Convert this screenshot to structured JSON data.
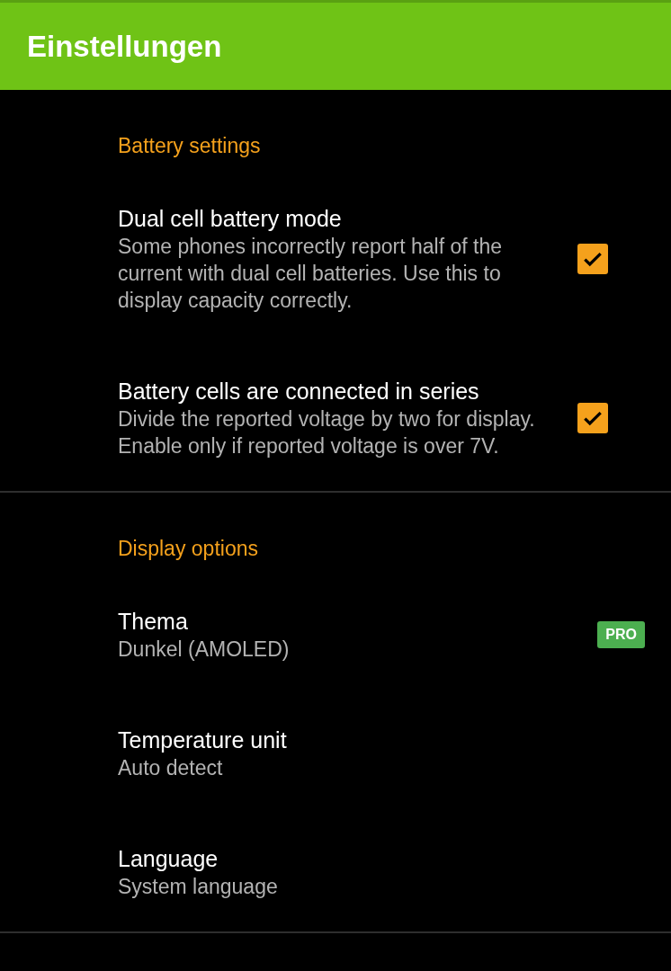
{
  "app_bar": {
    "title": "Einstellungen"
  },
  "sections": [
    {
      "title": "Battery settings",
      "items": [
        {
          "kind": "checkbox",
          "title": "Dual cell battery mode",
          "summary": "Some phones incorrectly report half of the current with dual cell batteries. Use this to display capacity correctly.",
          "checked": true
        },
        {
          "kind": "checkbox",
          "title": "Battery cells are connected in series",
          "summary": "Divide the reported voltage by two for display. Enable only if reported voltage is over 7V.",
          "checked": true
        }
      ]
    },
    {
      "title": "Display options",
      "items": [
        {
          "kind": "badge",
          "title": "Thema",
          "summary": "Dunkel (AMOLED)",
          "badge": "PRO"
        },
        {
          "kind": "plain",
          "title": "Temperature unit",
          "summary": "Auto detect"
        },
        {
          "kind": "plain",
          "title": "Language",
          "summary": "System language"
        }
      ]
    }
  ]
}
